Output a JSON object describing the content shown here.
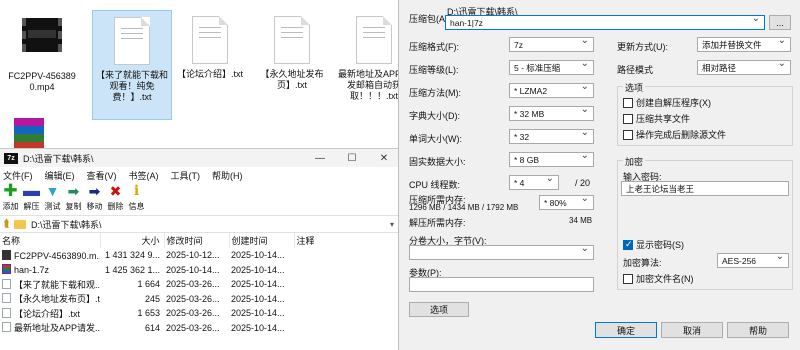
{
  "desktop": {
    "files": [
      {
        "name": "FC2PPV-456389 0.mp4",
        "kind": "video"
      },
      {
        "name": "【来了就能下载和观看！纯免费！】.txt",
        "kind": "text"
      },
      {
        "name": "【论坛介绍】.txt",
        "kind": "text"
      },
      {
        "name": "【永久地址发布页】.txt",
        "kind": "text"
      },
      {
        "name": "最新地址及APP请发邮箱自动获取！！！.txt",
        "kind": "text"
      }
    ]
  },
  "file_manager": {
    "title": "D:\\迅雷下载\\韩系\\",
    "icon_text": "7z",
    "menu": [
      "文件(F)",
      "编辑(E)",
      "查看(V)",
      "书签(A)",
      "工具(T)",
      "帮助(H)"
    ],
    "toolbar": [
      {
        "label": "添加",
        "icon": "plus-icon",
        "color": "#1e9e1e"
      },
      {
        "label": "解压",
        "icon": "minus-icon",
        "color": "#2a3fb0"
      },
      {
        "label": "测试",
        "icon": "check-arrow-icon",
        "color": "#2aa8c8"
      },
      {
        "label": "复制",
        "icon": "copy-arrow-icon",
        "color": "#1e8e5a"
      },
      {
        "label": "移动",
        "icon": "move-arrow-icon",
        "color": "#1a2a8a"
      },
      {
        "label": "删除",
        "icon": "delete-x-icon",
        "color": "#d01010"
      },
      {
        "label": "信息",
        "icon": "info-icon",
        "color": "#d8a800"
      }
    ],
    "address": "D:\\迅雷下载\\韩系\\",
    "columns": [
      "名称",
      "大小",
      "修改时间",
      "创建时间",
      "注释"
    ],
    "rows": [
      {
        "name": "FC2PPV-4563890.m...",
        "size": "1 431 324 9...",
        "modified": "2025-10-12...",
        "created": "2025-10-14...",
        "kind": "vid"
      },
      {
        "name": "han-1.7z",
        "size": "1 425 362 1...",
        "modified": "2025-10-14...",
        "created": "2025-10-14...",
        "kind": "arc"
      },
      {
        "name": "【来了就能下载和观...",
        "size": "1 664",
        "modified": "2025-03-26...",
        "created": "2025-10-14...",
        "kind": "txt"
      },
      {
        "name": "【永久地址发布页】.t...",
        "size": "245",
        "modified": "2025-03-26...",
        "created": "2025-10-14...",
        "kind": "txt"
      },
      {
        "name": "【论坛介绍】.txt",
        "size": "1 653",
        "modified": "2025-03-26...",
        "created": "2025-10-14...",
        "kind": "txt"
      },
      {
        "name": "最新地址及APP请发...",
        "size": "614",
        "modified": "2025-03-26...",
        "created": "2025-10-14...",
        "kind": "txt"
      }
    ]
  },
  "dialog": {
    "archive_label": "压缩包(A):",
    "archive_dir": "D:\\迅雷下载\\韩系\\",
    "archive_name": "han-1|7z",
    "browse_label": "...",
    "format_label": "压缩格式(F):",
    "format_value": "7z",
    "level_label": "压缩等级(L):",
    "level_value": "5 - 标准压缩",
    "method_label": "压缩方法(M):",
    "method_value": "* LZMA2",
    "dict_label": "字典大小(D):",
    "dict_value": "* 32 MB",
    "word_label": "单词大小(W):",
    "word_value": "* 32",
    "solid_label": "固实数据大小:",
    "solid_value": "* 8 GB",
    "threads_label": "CPU 线程数:",
    "threads_value": "* 4",
    "threads_max": "/ 20",
    "mem_comp_label": "压缩所需内存:",
    "mem_comp_value": "1296 MB / 1434 MB / 1792 MB",
    "mem_pct": "* 80%",
    "mem_decomp_label": "解压所需内存:",
    "mem_decomp_value": "34 MB",
    "split_label": "分卷大小，字节(V):",
    "split_value": "",
    "params_label": "参数(P):",
    "params_value": "",
    "options_button": "选项",
    "update_label": "更新方式(U):",
    "update_value": "添加并替换文件",
    "pathmode_label": "路径模式",
    "pathmode_value": "相对路径",
    "options_group": "选项",
    "opt_sfx": "创建自解压程序(X)",
    "opt_shared": "压缩共享文件",
    "opt_delete": "操作完成后删除源文件",
    "encrypt_group": "加密",
    "password_label": "输入密码:",
    "password_value": "上老王论坛当老王",
    "show_password": "显示密码(S)",
    "enc_method_label": "加密算法:",
    "enc_method_value": "AES-256",
    "enc_names": "加密文件名(N)",
    "ok_button": "确定",
    "cancel_button": "取消",
    "help_button": "帮助"
  }
}
